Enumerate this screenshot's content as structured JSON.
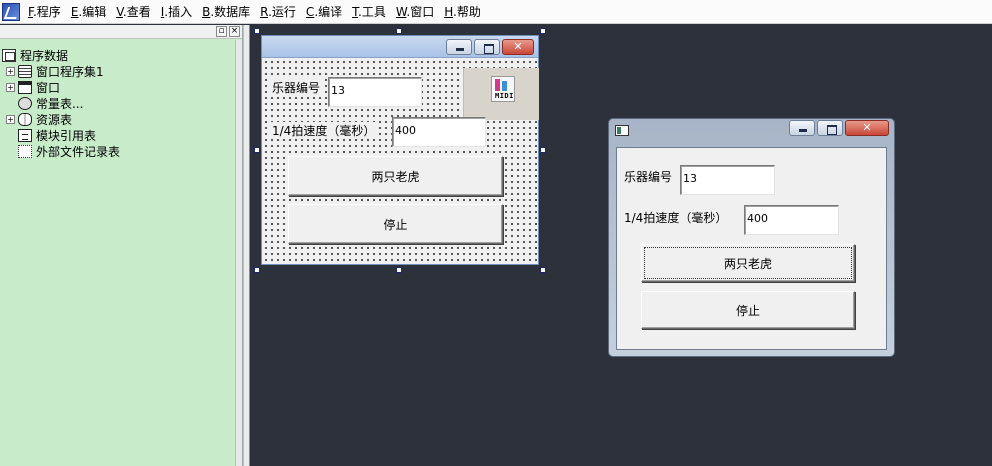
{
  "menu": {
    "items": [
      {
        "key": "F",
        "label": ".程序"
      },
      {
        "key": "E",
        "label": ".编辑"
      },
      {
        "key": "V",
        "label": ".查看"
      },
      {
        "key": "I",
        "label": ".插入"
      },
      {
        "key": "B",
        "label": ".数据库"
      },
      {
        "key": "R",
        "label": ".运行"
      },
      {
        "key": "C",
        "label": ".编译"
      },
      {
        "key": "T",
        "label": ".工具"
      },
      {
        "key": "W",
        "label": ".窗口"
      },
      {
        "key": "H",
        "label": ".帮助"
      }
    ]
  },
  "panel": {
    "pin_label": "▫",
    "close_label": "×"
  },
  "tree": {
    "root": "程序数据",
    "items": [
      {
        "label": "窗口程序集1",
        "expander": "+",
        "icon": "stack-icon"
      },
      {
        "label": "窗口",
        "expander": "+",
        "icon": "window-icon"
      },
      {
        "label": "常量表...",
        "expander": "",
        "icon": "constant-icon"
      },
      {
        "label": "资源表",
        "expander": "+",
        "icon": "resource-icon"
      },
      {
        "label": "模块引用表",
        "expander": "",
        "icon": "module-icon"
      },
      {
        "label": "外部文件记录表",
        "expander": "",
        "icon": "external-file-icon"
      }
    ]
  },
  "design_form": {
    "instrument_label": "乐器编号",
    "instrument_value": "13",
    "speed_label": "1/4拍速度（毫秒）",
    "speed_value": "400",
    "play_button": "两只老虎",
    "stop_button": "停止",
    "midi_text": "MIDI",
    "close_glyph": "✕"
  },
  "runtime_window": {
    "instrument_label": "乐器编号",
    "instrument_value": "13",
    "speed_label": "1/4拍速度（毫秒）",
    "speed_value": "400",
    "play_button": "两只老虎",
    "stop_button": "停止",
    "close_glyph": "✕"
  },
  "colors": {
    "workspace": "#2d313c",
    "left_panel": "#c8ecca",
    "close_button": "#c9473a"
  }
}
